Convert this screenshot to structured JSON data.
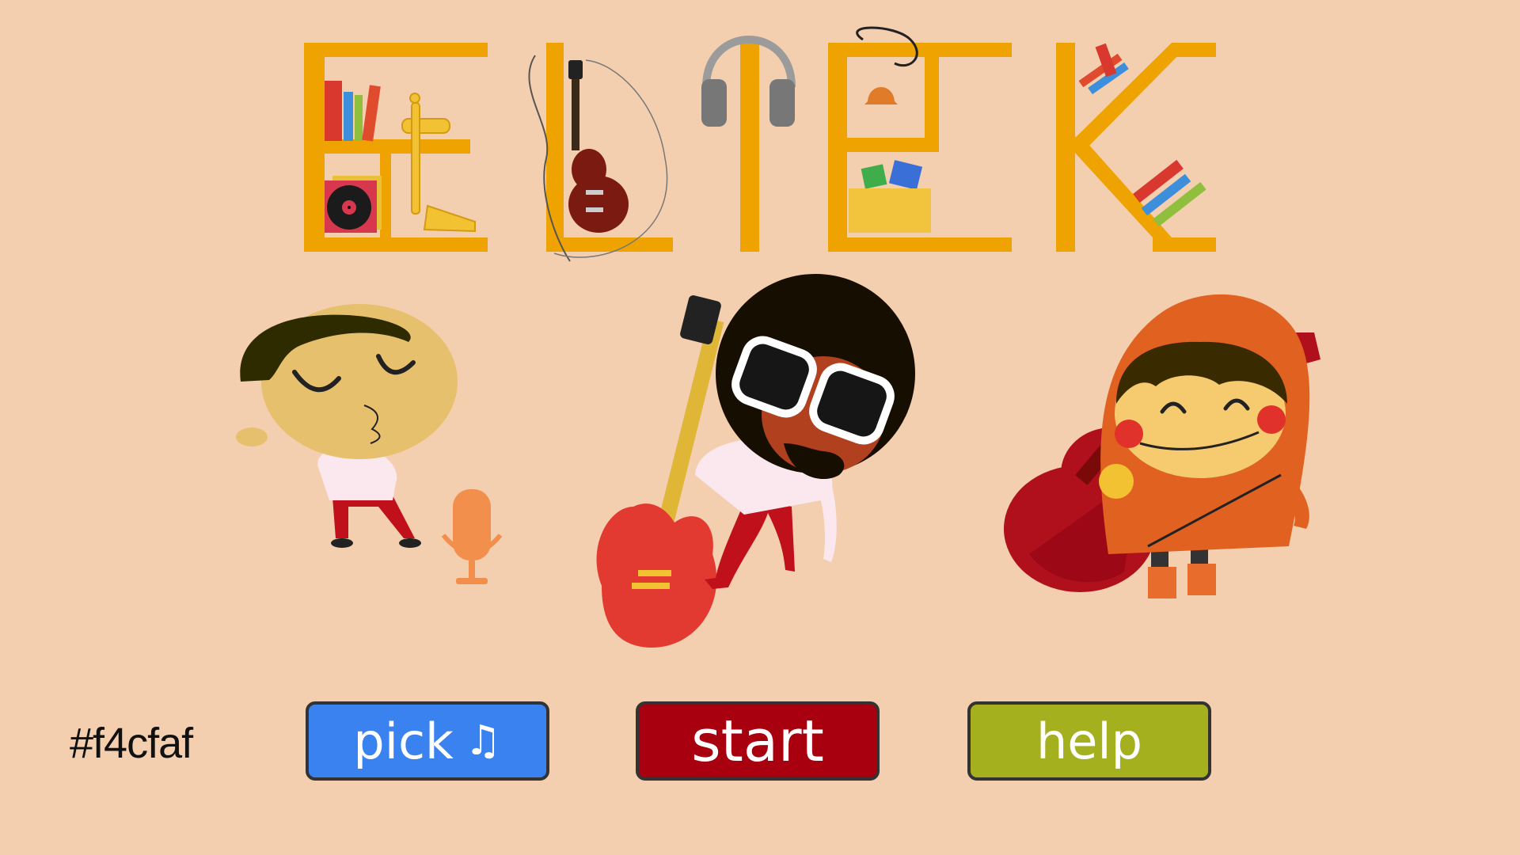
{
  "title": {
    "letters": [
      "E",
      "L",
      "I",
      "E",
      "K"
    ]
  },
  "background_hex": "#f4cfaf",
  "colors": {
    "background": "#f4cfaf",
    "letter": "#eea300",
    "pick_button": "#3a82f0",
    "start_button": "#a8000f",
    "help_button": "#a4b01e"
  },
  "buttons": {
    "pick_label": "pick",
    "pick_icon": "music-note-icon",
    "start_label": "start",
    "help_label": "help"
  },
  "characters": [
    {
      "name": "singer",
      "icon": "singer-character"
    },
    {
      "name": "guitarist",
      "icon": "afro-guitarist-character"
    },
    {
      "name": "hooded-kid",
      "icon": "hooded-guitar-kid-character"
    }
  ]
}
